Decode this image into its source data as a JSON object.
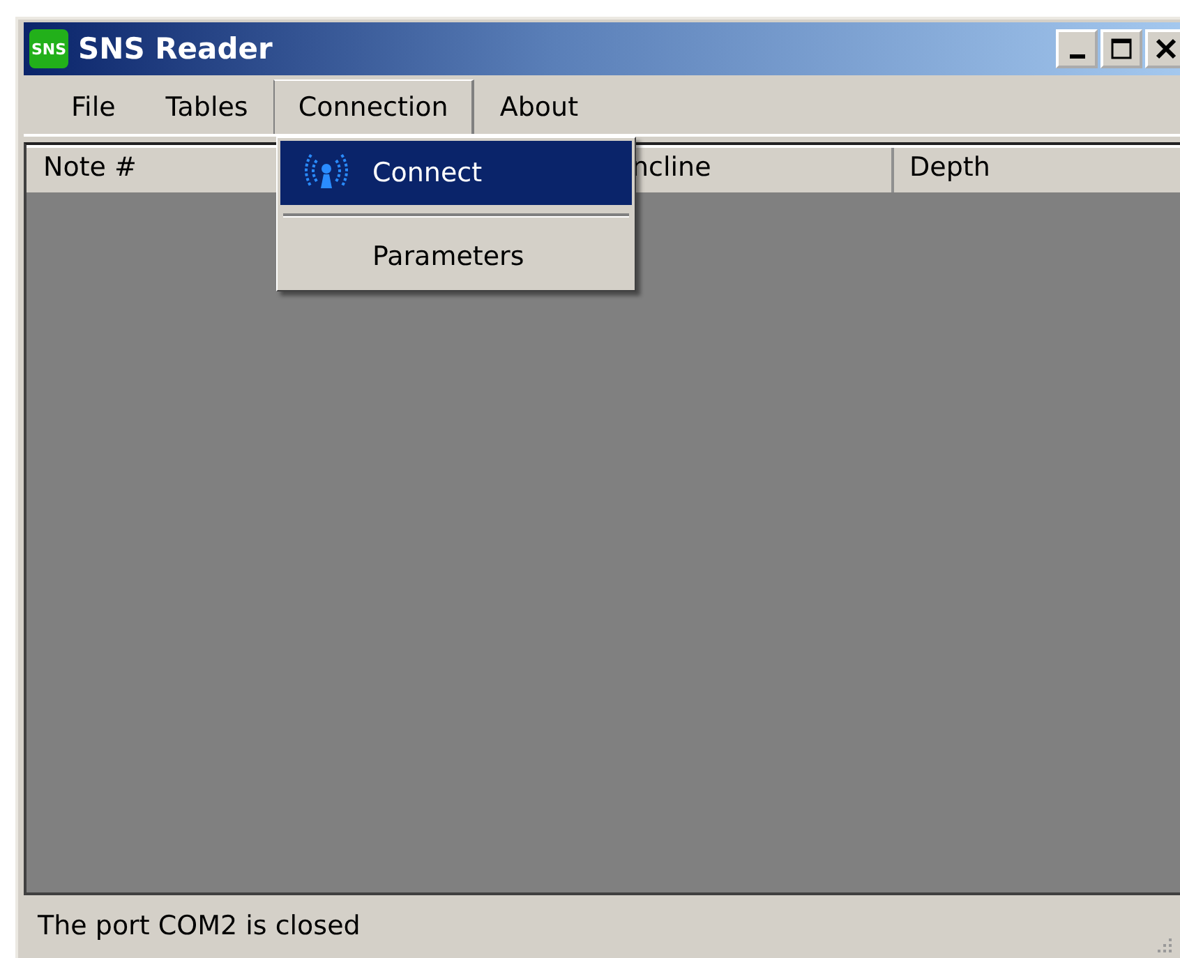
{
  "window": {
    "title": "SNS Reader",
    "logo": "SNS"
  },
  "menu_bar": [
    {
      "label": "File",
      "selected": false
    },
    {
      "label": "Tables",
      "selected": false
    },
    {
      "label": "Connection",
      "selected": true
    },
    {
      "label": "About",
      "selected": false
    }
  ],
  "dropdown": [
    {
      "kind": "icon_item",
      "label": "Connect",
      "selected": true
    },
    {
      "kind": "separator"
    },
    {
      "kind": "item",
      "label": "Parameters",
      "selected": false
    }
  ],
  "table": {
    "columns": [
      "Note #",
      "ncline",
      "Depth"
    ]
  },
  "status_bar": {
    "text": "The port COM2 is closed"
  }
}
